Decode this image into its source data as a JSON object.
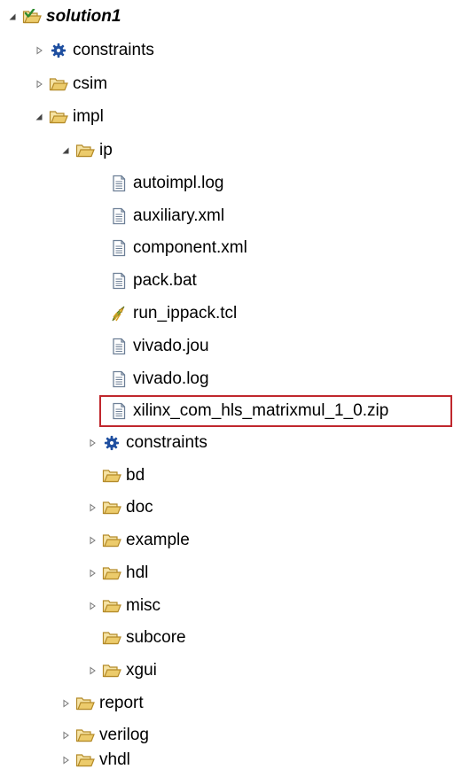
{
  "tree": {
    "solution": "solution1",
    "constraints": "constraints",
    "csim": "csim",
    "impl": "impl",
    "ip": "ip",
    "autoimpl_log": "autoimpl.log",
    "auxiliary_xml": "auxiliary.xml",
    "component_xml": "component.xml",
    "pack_bat": "pack.bat",
    "run_ippack_tcl": "run_ippack.tcl",
    "vivado_jou": "vivado.jou",
    "vivado_log": "vivado.log",
    "zip": "xilinx_com_hls_matrixmul_1_0.zip",
    "ip_constraints": "constraints",
    "bd": "bd",
    "doc": "doc",
    "example": "example",
    "hdl": "hdl",
    "misc": "misc",
    "subcore": "subcore",
    "xgui": "xgui",
    "report": "report",
    "verilog": "verilog",
    "vhdl": "vhdl"
  },
  "colors": {
    "folder": "#e9c36a",
    "highlight_border": "#c0272d"
  }
}
